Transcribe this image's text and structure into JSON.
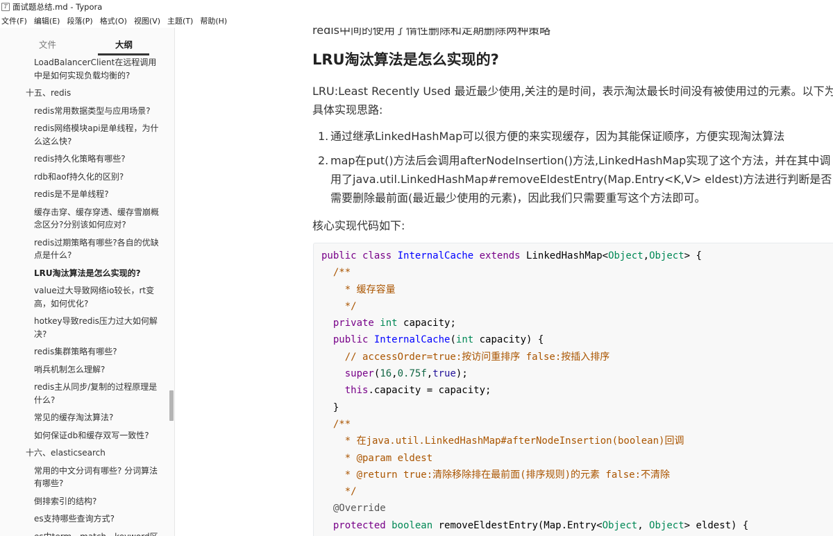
{
  "window": {
    "title": "面试题总结.md - Typora",
    "menu": [
      "文件(F)",
      "编辑(E)",
      "段落(P)",
      "格式(O)",
      "视图(V)",
      "主题(T)",
      "帮助(H)"
    ]
  },
  "sidebar": {
    "tabs": {
      "files": "文件",
      "outline": "大纲"
    },
    "outline": [
      {
        "level": 2,
        "text": "LoadBalancerClient在远程调用中是如何实现负载均衡的?"
      },
      {
        "level": 1,
        "text": "十五、redis"
      },
      {
        "level": 2,
        "text": "redis常用数据类型与应用场景?"
      },
      {
        "level": 2,
        "text": "redis网络模块api是单线程，为什么这么快?"
      },
      {
        "level": 2,
        "text": "redis持久化策略有哪些?"
      },
      {
        "level": 2,
        "text": "rdb和aof持久化的区别?"
      },
      {
        "level": 2,
        "text": "redis是不是单线程?"
      },
      {
        "level": 2,
        "text": "缓存击穿、缓存穿透、缓存雪崩概念区分?分别该如何应对?"
      },
      {
        "level": 2,
        "text": "redis过期策略有哪些?各自的优缺点是什么?"
      },
      {
        "level": 2,
        "text": "LRU淘汰算法是怎么实现的?",
        "active": true
      },
      {
        "level": 2,
        "text": "value过大导致网络io较长，rt变高，如何优化?"
      },
      {
        "level": 2,
        "text": "hotkey导致redis压力过大如何解决?"
      },
      {
        "level": 2,
        "text": "redis集群策略有哪些?"
      },
      {
        "level": 2,
        "text": "哨兵机制怎么理解?"
      },
      {
        "level": 2,
        "text": "redis主从同步/复制的过程原理是什么?"
      },
      {
        "level": 2,
        "text": "常见的缓存淘汰算法?"
      },
      {
        "level": 2,
        "text": "如何保证db和缓存双写一致性?"
      },
      {
        "level": 1,
        "text": "十六、elasticsearch"
      },
      {
        "level": 2,
        "text": "常用的中文分词有哪些? 分词算法有哪些?"
      },
      {
        "level": 2,
        "text": "倒排索引的结构?"
      },
      {
        "level": 2,
        "text": "es支持哪些查询方式?"
      },
      {
        "level": 2,
        "text": "es中term、match、keyword区"
      }
    ]
  },
  "editor": {
    "top_cut_text": "redis中间的使用了惰性删除和定期删除两种策略",
    "heading": "LRU淘汰算法是怎么实现的?",
    "paragraph": "LRU:Least Recently Used 最近最少使用,关注的是时间，表示淘汰最长时间没有被使用过的元素。以下为具体实现思路:",
    "list": [
      "通过继承LinkedHashMap可以很方便的来实现缓存，因为其能保证顺序，方便实现淘汰算法",
      "map在put()方法后会调用afterNodeInsertion()方法,LinkedHashMap实现了这个方法，并在其中调用了java.util.LinkedHashMap#removeEldestEntry(Map.Entry<K,V> eldest)方法进行判断是否需要删除最前面(最近最少使用的元素)，因此我们只需要重写这个方法即可。"
    ],
    "core_label": "核心实现代码如下:",
    "code": [
      [
        [
          "kw",
          "public "
        ],
        [
          "kw",
          "class "
        ],
        [
          "df",
          "InternalCache "
        ],
        [
          "kw",
          "extends "
        ],
        [
          "va",
          "LinkedHashMap<"
        ],
        [
          "ty",
          "Object"
        ],
        [
          "va",
          ","
        ],
        [
          "ty",
          "Object"
        ],
        [
          "va",
          "> {"
        ]
      ],
      [
        [
          "va",
          "  "
        ],
        [
          "cm",
          "/**"
        ]
      ],
      [
        [
          "va",
          "  "
        ],
        [
          "cm",
          "  * 缓存容量"
        ]
      ],
      [
        [
          "va",
          "  "
        ],
        [
          "cm",
          "  */"
        ]
      ],
      [
        [
          "va",
          "  "
        ],
        [
          "kw",
          "private "
        ],
        [
          "ty",
          "int "
        ],
        [
          "va",
          "capacity;"
        ]
      ],
      [
        [
          "va",
          "  "
        ],
        [
          "kw",
          "public "
        ],
        [
          "df",
          "InternalCache"
        ],
        [
          "va",
          "("
        ],
        [
          "ty",
          "int "
        ],
        [
          "va",
          "capacity) {"
        ]
      ],
      [
        [
          "va",
          "    "
        ],
        [
          "cm",
          "// accessOrder=true:按访问重排序 false:按插入排序"
        ]
      ],
      [
        [
          "va",
          "    "
        ],
        [
          "kw",
          "super"
        ],
        [
          "va",
          "("
        ],
        [
          "nm",
          "16"
        ],
        [
          "va",
          ","
        ],
        [
          "nm",
          "0.75f"
        ],
        [
          "va",
          ","
        ],
        [
          "bl",
          "true"
        ],
        [
          "va",
          ");"
        ]
      ],
      [
        [
          "va",
          "    "
        ],
        [
          "kw",
          "this"
        ],
        [
          "va",
          ".capacity = capacity;"
        ]
      ],
      [
        [
          "va",
          "  }"
        ]
      ],
      [
        [
          "va",
          "  "
        ],
        [
          "cm",
          "/**"
        ]
      ],
      [
        [
          "va",
          "  "
        ],
        [
          "cm",
          "  * 在java.util.LinkedHashMap#afterNodeInsertion(boolean)回调"
        ]
      ],
      [
        [
          "va",
          "  "
        ],
        [
          "cm",
          "  * @param eldest"
        ]
      ],
      [
        [
          "va",
          "  "
        ],
        [
          "cm",
          "  * @return true:清除移除排在最前面(排序规则)的元素 false:不清除"
        ]
      ],
      [
        [
          "va",
          "  "
        ],
        [
          "cm",
          "  */"
        ]
      ],
      [
        [
          "va",
          "  "
        ],
        [
          "at",
          "@Override"
        ]
      ],
      [
        [
          "va",
          "  "
        ],
        [
          "kw",
          "protected "
        ],
        [
          "ty",
          "boolean "
        ],
        [
          "va",
          "removeEldestEntry(Map.Entry<"
        ],
        [
          "ty",
          "Object"
        ],
        [
          "va",
          ", "
        ],
        [
          "ty",
          "Object"
        ],
        [
          "va",
          "> eldest) {"
        ]
      ]
    ]
  }
}
